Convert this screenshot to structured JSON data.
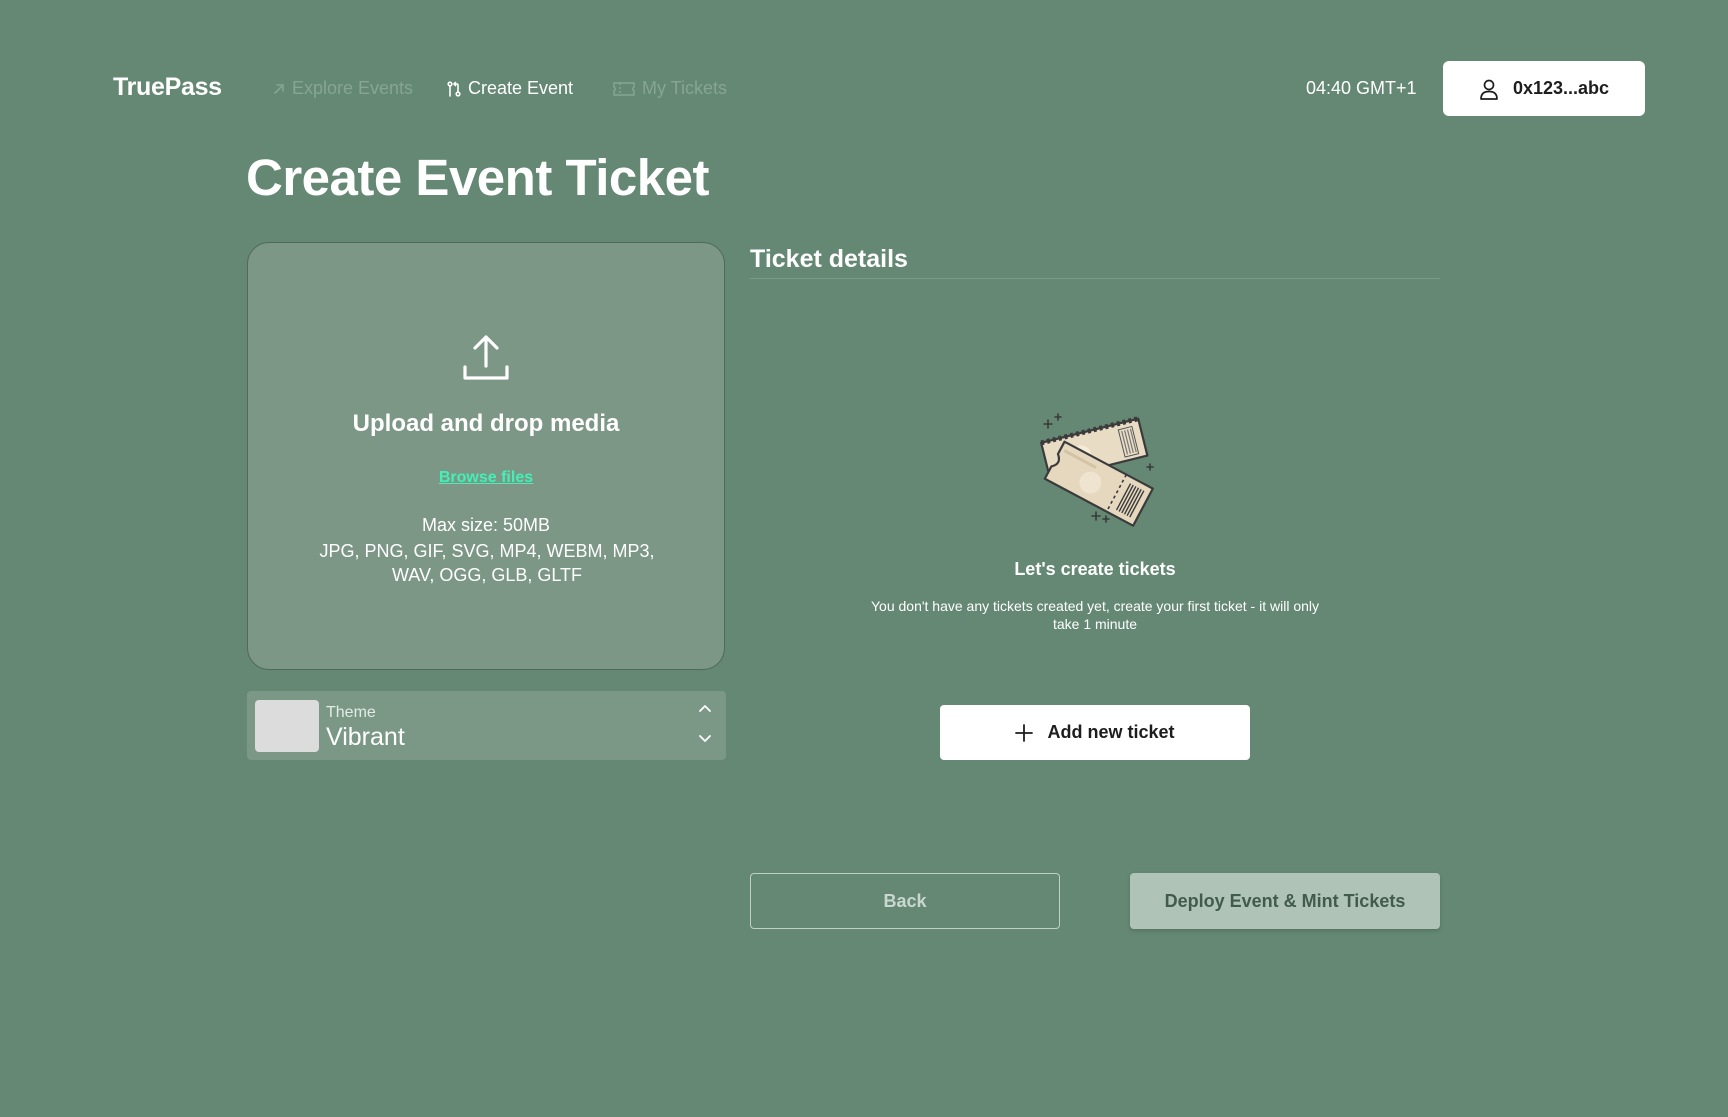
{
  "header": {
    "logo": "TruePass",
    "nav": [
      {
        "label": "Explore Events",
        "icon": "arrow-up-right-icon",
        "active": false
      },
      {
        "label": "Create Event",
        "icon": "git-pull-request-icon",
        "active": true
      },
      {
        "label": "My Tickets",
        "icon": "ticket-icon",
        "active": false
      }
    ],
    "clock": "04:40 GMT+1",
    "wallet": {
      "label": "0x123...abc",
      "icon": "user-icon"
    }
  },
  "page": {
    "title": "Create Event Ticket"
  },
  "upload": {
    "title": "Upload and drop media",
    "browse_label": "Browse files",
    "max_size": "Max size: 50MB",
    "formats": "JPG, PNG, GIF, SVG, MP4, WEBM, MP3, WAV, OGG, GLB, GLTF"
  },
  "theme": {
    "label": "Theme",
    "value": "Vibrant"
  },
  "ticket_details": {
    "title": "Ticket details",
    "empty_title": "Let's create tickets",
    "empty_description": "You don't have any tickets created yet, create your first ticket - it will only take 1 minute",
    "add_button": "Add new ticket"
  },
  "actions": {
    "back": "Back",
    "deploy": "Deploy Event & Mint Tickets"
  },
  "colors": {
    "background": "#648873",
    "upload_panel": "#7d9786",
    "link_accent": "#43f0b8",
    "deploy_disabled": "#afc4b7"
  }
}
